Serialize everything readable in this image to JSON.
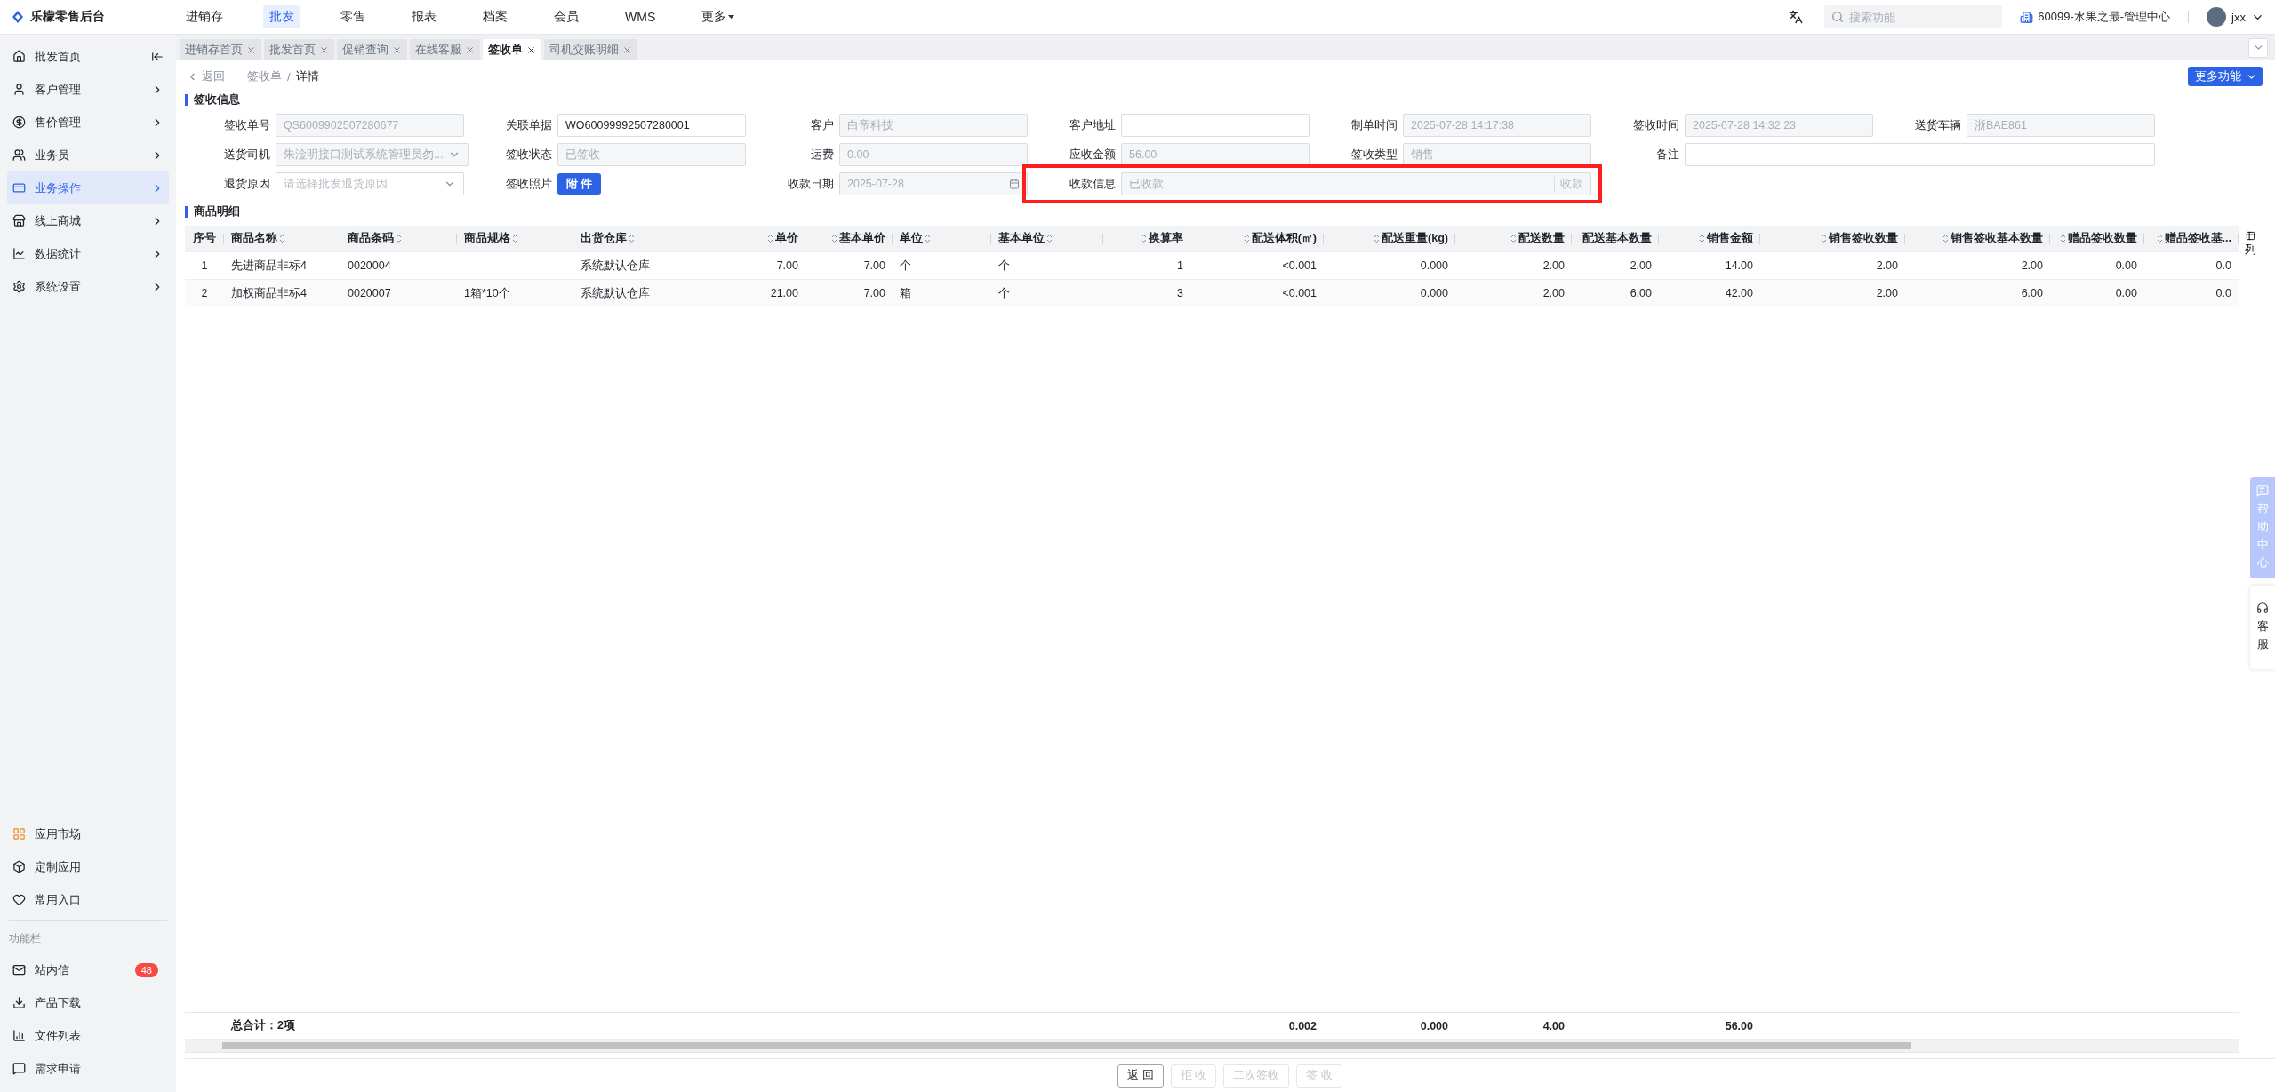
{
  "app": {
    "logo_text": "乐檬零售后台"
  },
  "top_menu": [
    {
      "label": "进销存",
      "selected": false,
      "dropdown": false
    },
    {
      "label": "批发",
      "selected": true,
      "dropdown": false
    },
    {
      "label": "零售",
      "selected": false,
      "dropdown": false
    },
    {
      "label": "报表",
      "selected": false,
      "dropdown": false
    },
    {
      "label": "档案",
      "selected": false,
      "dropdown": false
    },
    {
      "label": "会员",
      "selected": false,
      "dropdown": false
    },
    {
      "label": "WMS",
      "selected": false,
      "dropdown": false
    },
    {
      "label": "更多",
      "selected": false,
      "dropdown": true
    }
  ],
  "header": {
    "search_placeholder": "搜索功能",
    "store": "60099-水果之最-管理中心",
    "user": "jxx"
  },
  "sidebar": {
    "items": [
      {
        "label": "批发首页",
        "selected": false,
        "has_children": false
      },
      {
        "label": "客户管理",
        "selected": false,
        "has_children": true
      },
      {
        "label": "售价管理",
        "selected": false,
        "has_children": true
      },
      {
        "label": "业务员",
        "selected": false,
        "has_children": true
      },
      {
        "label": "业务操作",
        "selected": true,
        "has_children": true
      },
      {
        "label": "线上商城",
        "selected": false,
        "has_children": true
      },
      {
        "label": "数据统计",
        "selected": false,
        "has_children": true
      },
      {
        "label": "系统设置",
        "selected": false,
        "has_children": true
      }
    ],
    "apps": [
      {
        "label": "应用市场"
      },
      {
        "label": "定制应用"
      },
      {
        "label": "常用入口"
      }
    ],
    "section_title": "功能栏",
    "tools": [
      {
        "label": "站内信",
        "badge": "48"
      },
      {
        "label": "产品下载"
      },
      {
        "label": "文件列表"
      },
      {
        "label": "需求申请"
      }
    ]
  },
  "tabs": [
    {
      "label": "进销存首页",
      "selected": false
    },
    {
      "label": "批发首页",
      "selected": false
    },
    {
      "label": "促销查询",
      "selected": false
    },
    {
      "label": "在线客服",
      "selected": false
    },
    {
      "label": "签收单",
      "selected": true
    },
    {
      "label": "司机交账明细",
      "selected": false
    }
  ],
  "breadcrumb": {
    "back": "返回",
    "separator": "/",
    "items": [
      "签收单",
      "详情"
    ]
  },
  "more_button": "更多功能",
  "sign_info": {
    "title": "签收信息",
    "rows": [
      [
        {
          "label": "签收单号",
          "kind": "text",
          "value": "QS6009902507280677",
          "disabled": true
        },
        {
          "label": "关联单据",
          "kind": "text",
          "value": "WO60099992507280001",
          "disabled": false
        },
        {
          "label": "客户",
          "kind": "text",
          "value": "白帝科技",
          "disabled": true
        },
        {
          "label": "客户地址",
          "kind": "text"
        },
        {
          "label": "制单时间",
          "kind": "text",
          "value": "2025-07-28 14:17:38",
          "disabled": true
        },
        {
          "label": "签收时间",
          "kind": "text",
          "value": "2025-07-28 14:32:23",
          "disabled": true
        },
        {
          "label": "送货车辆",
          "kind": "text",
          "value": "浙BAE861",
          "disabled": true
        }
      ],
      [
        {
          "label": "送货司机",
          "kind": "select",
          "value": "朱淦明接口测试系统管理员勿...",
          "disabled": true
        },
        {
          "label": "签收状态",
          "kind": "text",
          "value": "已签收",
          "disabled": true
        },
        {
          "label": "运费",
          "kind": "text",
          "value": "0.00",
          "disabled": true
        },
        {
          "label": "应收金额",
          "kind": "text",
          "value": "56.00",
          "disabled": true
        },
        {
          "label": "签收类型",
          "kind": "text",
          "value": "销售",
          "disabled": true
        },
        {
          "label": "备注",
          "kind": "note"
        }
      ],
      [
        {
          "label": "退货原因",
          "kind": "select",
          "placeholder": "请选择批发退货原因"
        },
        {
          "label": "签收照片",
          "kind": "attachment",
          "button": "附 件"
        },
        {
          "label": "收款日期",
          "kind": "date",
          "value": "2025-07-28",
          "disabled": true
        },
        {
          "label": "收款信息",
          "kind": "payment",
          "value": "已收款",
          "suffix": "收款",
          "disabled": true,
          "highlighted": true
        }
      ]
    ]
  },
  "goods": {
    "title": "商品明细",
    "columns": [
      {
        "label": "序号",
        "kind": "index"
      },
      {
        "label": "商品名称",
        "kind": "text"
      },
      {
        "label": "商品条码",
        "kind": "text"
      },
      {
        "label": "商品规格",
        "kind": "text"
      },
      {
        "label": "出货仓库",
        "kind": "text"
      },
      {
        "label": "单价",
        "kind": "number"
      },
      {
        "label": "基本单价",
        "kind": "number"
      },
      {
        "label": "单位",
        "kind": "text"
      },
      {
        "label": "基本单位",
        "kind": "text"
      },
      {
        "label": "换算率",
        "kind": "number"
      },
      {
        "label": "配送体积(㎡)",
        "kind": "number",
        "total": "0.002"
      },
      {
        "label": "配送重量(kg)",
        "kind": "number",
        "total": "0.000"
      },
      {
        "label": "配送数量",
        "kind": "number",
        "total": "4.00"
      },
      {
        "label": "配送基本数量",
        "kind": "number"
      },
      {
        "label": "销售金额",
        "kind": "number",
        "total": "56.00"
      },
      {
        "label": "销售签收数量",
        "kind": "number"
      },
      {
        "label": "销售签收基本数量",
        "kind": "number"
      },
      {
        "label": "赠品签收数量",
        "kind": "number"
      },
      {
        "label": "赠品签收基...",
        "kind": "number"
      }
    ],
    "rows": [
      {
        "index": "1",
        "name": "先进商品非标4",
        "barcode": "0020004",
        "warehouse": "系统默认仓库",
        "price": "7.00",
        "base_price": "7.00",
        "unit": "个",
        "base_unit": "个",
        "rate": "1",
        "volume": "<0.001",
        "weight": "0.000",
        "qty": "2.00",
        "base_qty": "2.00",
        "amount": "14.00",
        "sign_qty": "2.00",
        "sign_base_qty": "2.00",
        "gift_qty": "0.00",
        "gift_base": "0.0"
      },
      {
        "index": "2",
        "name": "加权商品非标4",
        "barcode": "0020007",
        "spec": "1箱*10个",
        "warehouse": "系统默认仓库",
        "price": "21.00",
        "base_price": "7.00",
        "unit": "箱",
        "base_unit": "个",
        "rate": "3",
        "volume": "<0.001",
        "weight": "0.000",
        "qty": "2.00",
        "base_qty": "6.00",
        "amount": "42.00",
        "sign_qty": "2.00",
        "sign_base_qty": "6.00",
        "gift_qty": "0.00",
        "gift_base": "0.0"
      }
    ],
    "summary_label": "总合计：2项"
  },
  "column_settings": "列",
  "bottom_buttons": [
    {
      "label": "返 回",
      "disabled": false
    },
    {
      "label": "拒 收",
      "disabled": true
    },
    {
      "label": "二次签收",
      "disabled": true
    },
    {
      "label": "签 收",
      "disabled": true
    }
  ],
  "side_widgets": {
    "help": "帮助中心",
    "service": "客服"
  }
}
